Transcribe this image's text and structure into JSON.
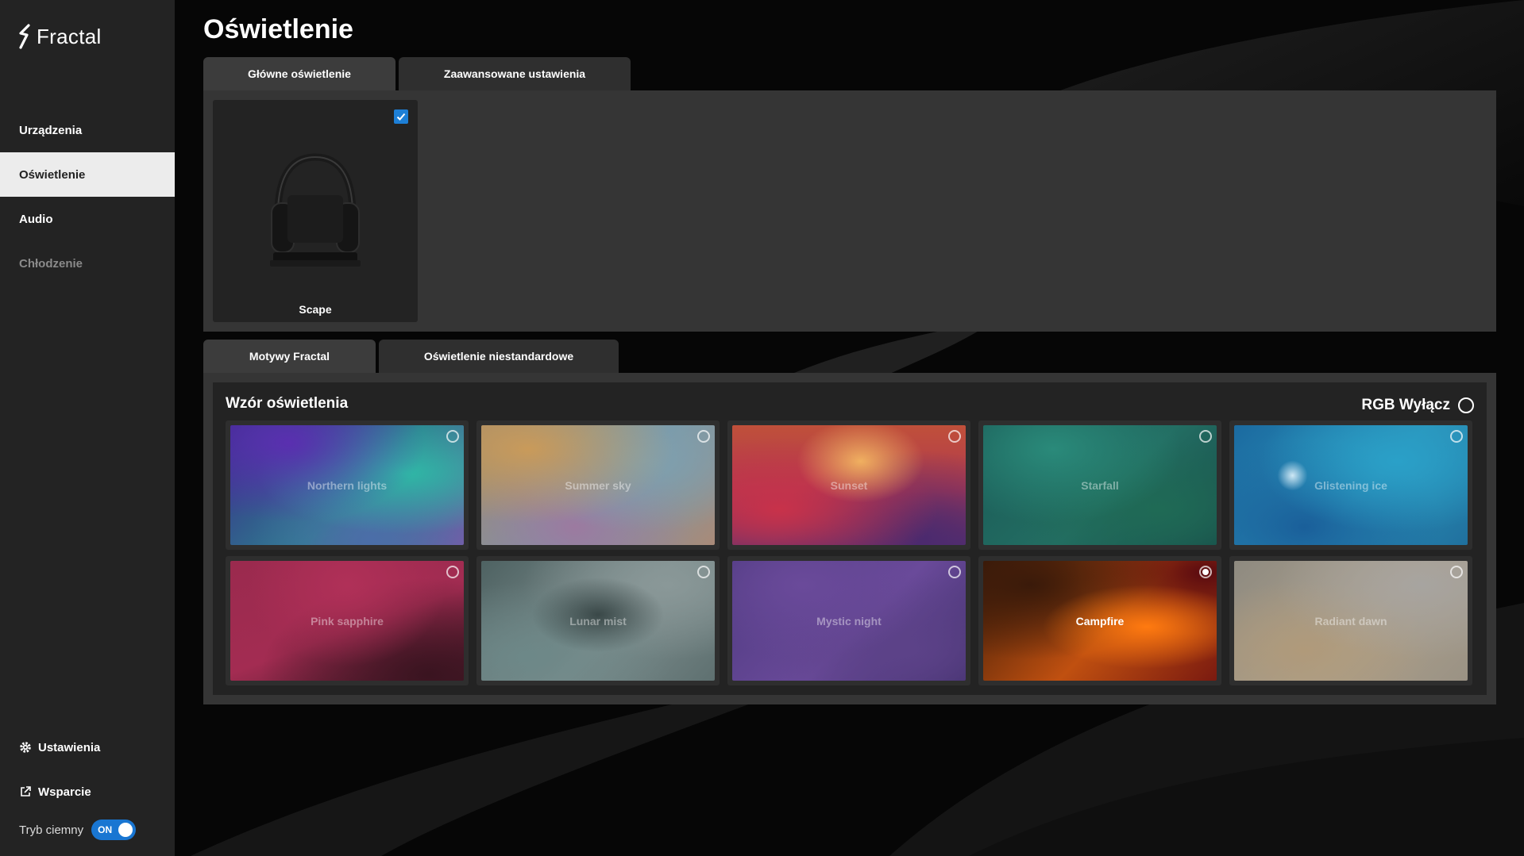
{
  "app": {
    "logo_text": "Fractal"
  },
  "sidebar": {
    "items": [
      {
        "label": "Urządzenia",
        "state": "normal"
      },
      {
        "label": "Oświetlenie",
        "state": "active"
      },
      {
        "label": "Audio",
        "state": "normal"
      },
      {
        "label": "Chłodzenie",
        "state": "disabled"
      }
    ],
    "settings_label": "Ustawienia",
    "support_label": "Wsparcie",
    "dark_mode_label": "Tryb ciemny",
    "dark_mode_value": "ON"
  },
  "page": {
    "title": "Oświetlenie"
  },
  "top_tabs": [
    {
      "label": "Główne oświetlenie",
      "active": true
    },
    {
      "label": "Zaawansowane ustawienia",
      "active": false
    }
  ],
  "device": {
    "name": "Scape",
    "checked": true
  },
  "bottom_tabs": [
    {
      "label": "Motywy Fractal",
      "active": true
    },
    {
      "label": "Oświetlenie niestandardowe",
      "active": false
    }
  ],
  "themes": {
    "section_title": "Wzór oświetlenia",
    "rgb_off_label": "RGB Wyłącz",
    "items": [
      {
        "name": "Northern lights",
        "selected": false
      },
      {
        "name": "Summer sky",
        "selected": false
      },
      {
        "name": "Sunset",
        "selected": false
      },
      {
        "name": "Starfall",
        "selected": false
      },
      {
        "name": "Glistening ice",
        "selected": false
      },
      {
        "name": "Pink sapphire",
        "selected": false
      },
      {
        "name": "Lunar mist",
        "selected": false
      },
      {
        "name": "Mystic night",
        "selected": false
      },
      {
        "name": "Campfire",
        "selected": true
      },
      {
        "name": "Radiant dawn",
        "selected": false
      }
    ]
  },
  "colors": {
    "accent": "#1976d2",
    "sidebar_bg": "#232323",
    "active_nav_bg": "#ececec",
    "panel_bg": "#353535"
  }
}
